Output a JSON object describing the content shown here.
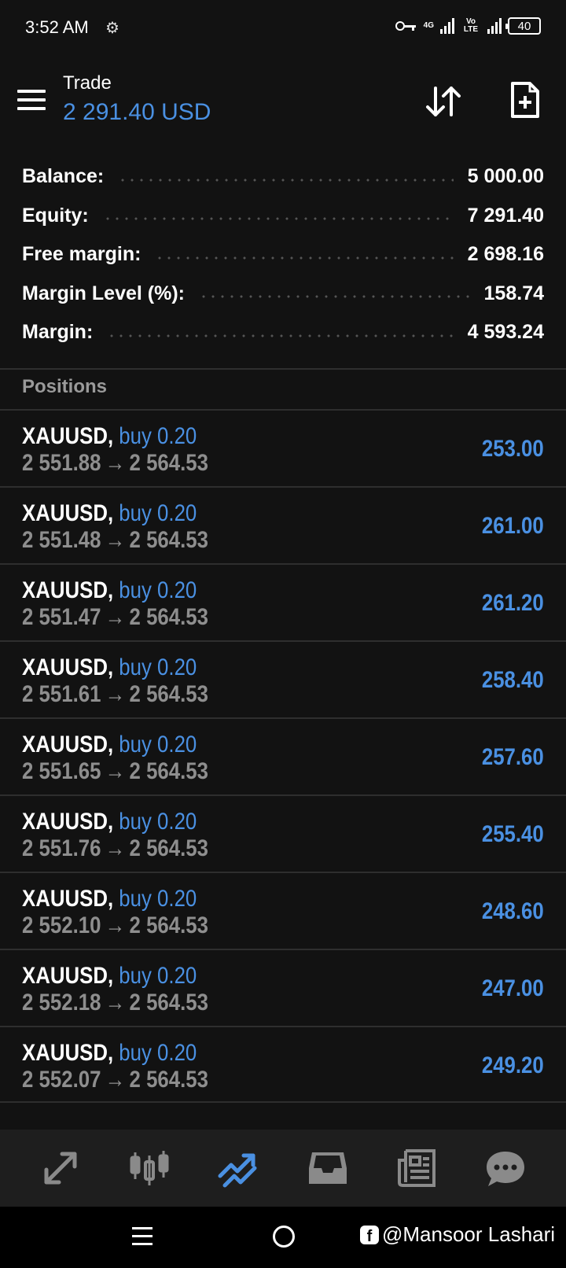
{
  "status_bar": {
    "time": "3:52 AM",
    "network_1": "4G",
    "network_2": "Vo LTE",
    "battery": "40"
  },
  "header": {
    "title": "Trade",
    "subtitle": "2 291.40 USD"
  },
  "summary": [
    {
      "label": "Balance:",
      "value": "5 000.00"
    },
    {
      "label": "Equity:",
      "value": "7 291.40"
    },
    {
      "label": "Free margin:",
      "value": "2 698.16"
    },
    {
      "label": "Margin Level (%):",
      "value": "158.74"
    },
    {
      "label": "Margin:",
      "value": "4 593.24"
    }
  ],
  "positions_heading": "Positions",
  "positions": [
    {
      "symbol": "XAUUSD,",
      "type": "buy 0.20",
      "open": "2 551.88",
      "arrow": "→",
      "current": "2 564.53",
      "profit": "253.00"
    },
    {
      "symbol": "XAUUSD,",
      "type": "buy 0.20",
      "open": "2 551.48",
      "arrow": "→",
      "current": "2 564.53",
      "profit": "261.00"
    },
    {
      "symbol": "XAUUSD,",
      "type": "buy 0.20",
      "open": "2 551.47",
      "arrow": "→",
      "current": "2 564.53",
      "profit": "261.20"
    },
    {
      "symbol": "XAUUSD,",
      "type": "buy 0.20",
      "open": "2 551.61",
      "arrow": "→",
      "current": "2 564.53",
      "profit": "258.40"
    },
    {
      "symbol": "XAUUSD,",
      "type": "buy 0.20",
      "open": "2 551.65",
      "arrow": "→",
      "current": "2 564.53",
      "profit": "257.60"
    },
    {
      "symbol": "XAUUSD,",
      "type": "buy 0.20",
      "open": "2 551.76",
      "arrow": "→",
      "current": "2 564.53",
      "profit": "255.40"
    },
    {
      "symbol": "XAUUSD,",
      "type": "buy 0.20",
      "open": "2 552.10",
      "arrow": "→",
      "current": "2 564.53",
      "profit": "248.60"
    },
    {
      "symbol": "XAUUSD,",
      "type": "buy 0.20",
      "open": "2 552.18",
      "arrow": "→",
      "current": "2 564.53",
      "profit": "247.00"
    },
    {
      "symbol": "XAUUSD,",
      "type": "buy 0.20",
      "open": "2 552.07",
      "arrow": "→",
      "current": "2 564.53",
      "profit": "249.20"
    }
  ],
  "tabs": [
    {
      "icon": "quotes-arrows-icon",
      "active": false
    },
    {
      "icon": "chart-candles-icon",
      "active": false
    },
    {
      "icon": "trade-trend-icon",
      "active": true
    },
    {
      "icon": "inbox-icon",
      "active": false
    },
    {
      "icon": "news-icon",
      "active": false
    },
    {
      "icon": "chat-icon",
      "active": false
    }
  ],
  "watermark": "@Mansoor Lashari",
  "colors": {
    "background": "#121212",
    "accent": "#4a90e2",
    "muted_text": "#8e8e8e",
    "tabbar": "#1e1e1e"
  }
}
